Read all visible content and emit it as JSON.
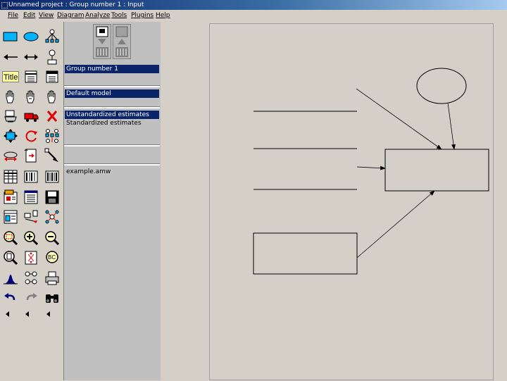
{
  "window": {
    "title": "Unnamed project : Group number 1 : Input"
  },
  "menu": [
    "File",
    "Edit",
    "View",
    "Diagram",
    "Analyze",
    "Tools",
    "Plugins",
    "Help"
  ],
  "toolbar_icons": [
    "draw-observed-variable-icon",
    "draw-unobserved-variable-icon",
    "draw-indicator-variable-icon",
    "draw-path-icon",
    "draw-covariance-icon",
    "add-unique-variable-icon",
    "title-icon",
    "list-variables-in-model-icon",
    "list-variables-in-dataset-icon",
    "select-one-object-icon",
    "select-all-objects-icon",
    "deselect-all-icon",
    "duplicate-icon",
    "move-icon",
    "erase-icon",
    "change-shape-icon",
    "rotate-indicators-icon",
    "reflect-indicators-icon",
    "move-parameter-icon",
    "scroll-icon",
    "touch-up-icon",
    "select-data-files-icon",
    "analysis-properties-icon",
    "calculate-estimates-icon",
    "view-text-output-icon",
    "view-text-icon",
    "save-diagram-icon",
    "object-properties-icon",
    "drag-properties-icon",
    "preserve-symmetries-icon",
    "zoom-selected-area-icon",
    "zoom-in-icon",
    "zoom-out-icon",
    "zoom-page-icon",
    "fit-to-page-icon",
    "loupe-icon",
    "bayesian-estimation-icon",
    "multiple-group-analysis-icon",
    "print-icon",
    "undo-icon",
    "redo-icon",
    "specification-search-icon",
    "scroll-left-icon",
    "scroll-left-icon",
    "scroll-left-icon"
  ],
  "mode_buttons": [
    "view-input-diagram-icon",
    "view-output-diagram-icon"
  ],
  "panels": {
    "groups": {
      "selected": "Group number 1"
    },
    "models": {
      "selected": "Default model"
    },
    "parameter_formats": {
      "items": [
        "Unstandardized estimates",
        "Standardized estimates"
      ],
      "selected_index": 0
    },
    "files": {
      "items": [
        "example.amw"
      ]
    }
  },
  "title_button_label": "Title"
}
